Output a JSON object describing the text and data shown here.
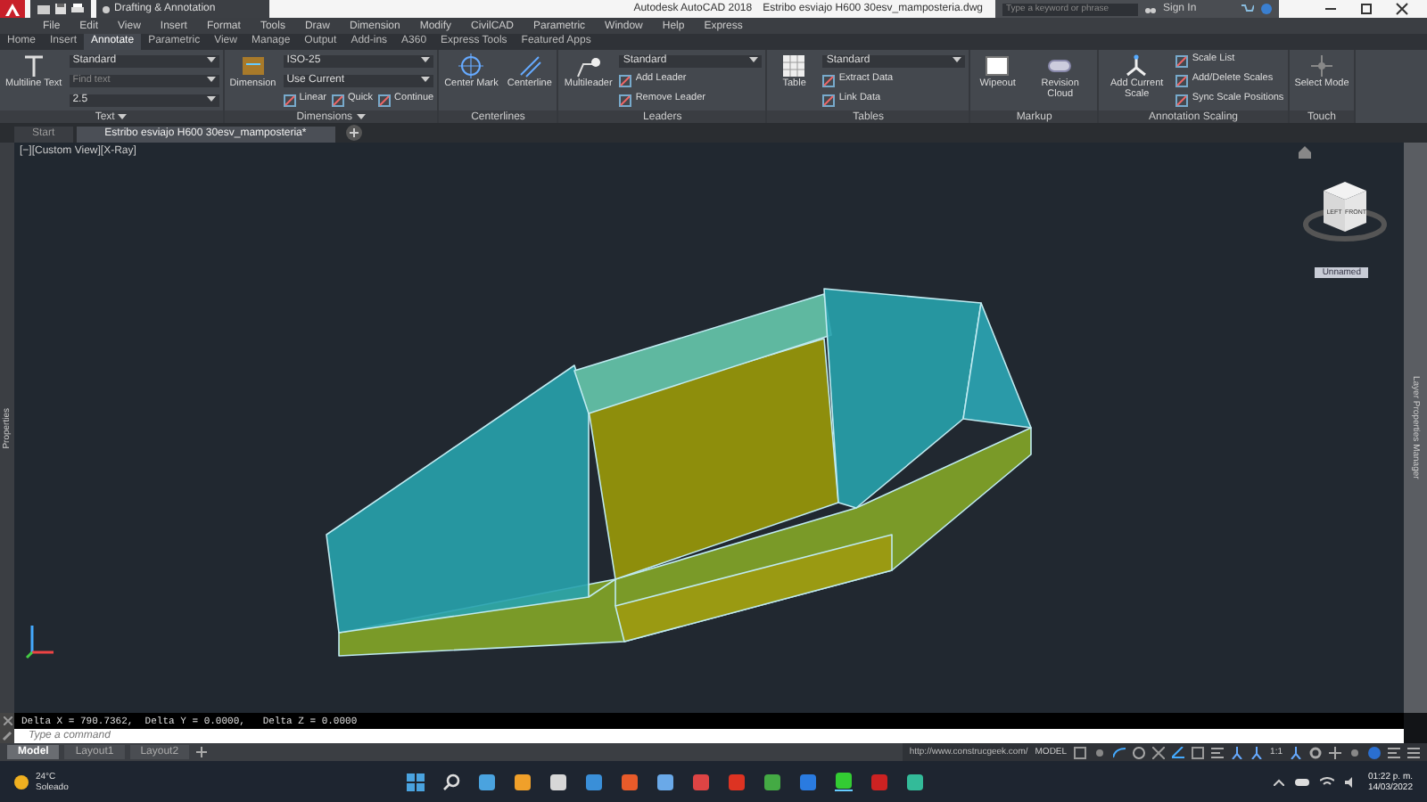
{
  "title_bar": {
    "workspace": "Drafting & Annotation",
    "title": "Autodesk AutoCAD 2018",
    "file": "Estribo esviajo H600 30esv_mamposteria.dwg",
    "search": {
      "placeholder": "Type a keyword or phrase"
    },
    "sign_in": "Sign In"
  },
  "menu": [
    "File",
    "Edit",
    "View",
    "Insert",
    "Format",
    "Tools",
    "Draw",
    "Dimension",
    "Modify",
    "CivilCAD",
    "Parametric",
    "Window",
    "Help",
    "Express"
  ],
  "ribbon_tabs": [
    {
      "label": "Home",
      "selected": false
    },
    {
      "label": "Insert",
      "selected": false
    },
    {
      "label": "Annotate",
      "selected": true
    },
    {
      "label": "Parametric",
      "selected": false
    },
    {
      "label": "View",
      "selected": false
    },
    {
      "label": "Manage",
      "selected": false
    },
    {
      "label": "Output",
      "selected": false
    },
    {
      "label": "Add-ins",
      "selected": false
    },
    {
      "label": "A360",
      "selected": false
    },
    {
      "label": "Express Tools",
      "selected": false
    },
    {
      "label": "Featured Apps",
      "selected": false
    }
  ],
  "ribbon_panels": [
    {
      "title": "Text",
      "expandable": true,
      "bigs": [
        "Multiline Text"
      ],
      "rows": [
        [
          {
            "kind": "combo",
            "value": "Standard"
          }
        ],
        [
          {
            "kind": "combo",
            "placeholder": "Find text"
          }
        ],
        [
          {
            "kind": "combo",
            "value": "2.5"
          }
        ]
      ]
    },
    {
      "title": "Dimensions",
      "expandable": true,
      "bigs": [
        "Dimension"
      ],
      "rows": [
        [
          {
            "kind": "combo",
            "value": "ISO-25"
          }
        ],
        [
          {
            "kind": "combo",
            "value": "Use Current"
          }
        ],
        [
          {
            "kind": "tool",
            "label": "Linear"
          },
          {
            "kind": "tool",
            "label": "Quick"
          },
          {
            "kind": "tool",
            "label": "Continue"
          }
        ]
      ]
    },
    {
      "title": "Centerlines",
      "expandable": false,
      "bigs": [
        "Center Mark",
        "Centerline"
      ]
    },
    {
      "title": "Leaders",
      "expandable": false,
      "bigs": [
        "Multileader"
      ],
      "rows": [
        [
          {
            "kind": "combo",
            "value": "Standard"
          }
        ],
        [
          {
            "kind": "tool",
            "label": "Add Leader"
          }
        ],
        [
          {
            "kind": "tool",
            "label": "Remove Leader"
          }
        ]
      ]
    },
    {
      "title": "Tables",
      "expandable": false,
      "bigs": [
        "Table"
      ],
      "rows": [
        [
          {
            "kind": "combo",
            "value": "Standard"
          }
        ],
        [
          {
            "kind": "tool",
            "label": "Extract Data"
          }
        ],
        [
          {
            "kind": "tool",
            "label": "Link Data"
          }
        ]
      ]
    },
    {
      "title": "Markup",
      "expandable": false,
      "bigs": [
        "Wipeout",
        "Revision Cloud"
      ]
    },
    {
      "title": "Annotation Scaling",
      "expandable": false,
      "bigs": [
        "Add Current Scale"
      ],
      "rows": [
        [
          {
            "kind": "tool",
            "label": "Scale List"
          }
        ],
        [
          {
            "kind": "tool",
            "label": "Add/Delete Scales"
          }
        ],
        [
          {
            "kind": "tool",
            "label": "Sync Scale Positions"
          }
        ]
      ]
    },
    {
      "title": "Touch",
      "expandable": false,
      "bigs": [
        "Select Mode"
      ]
    }
  ],
  "doc_tabs": [
    {
      "label": "Start",
      "selected": false
    },
    {
      "label": "Estribo esviajo H600 30esv_mamposteria*",
      "selected": true
    }
  ],
  "viewport": {
    "label": "[−][Custom View][X-Ray]",
    "view_name": "Unnamed",
    "cube_faces": [
      "LEFT",
      "FRONT"
    ]
  },
  "side_palettes": {
    "left": "Properties",
    "right": "Layer Properties Manager"
  },
  "command_line": {
    "history": "Delta X = 790.7362,  Delta Y = 0.0000,   Delta Z = 0.0000",
    "placeholder": "Type a command"
  },
  "layout_tabs": [
    {
      "label": "Model",
      "selected": true
    },
    {
      "label": "Layout1",
      "selected": false
    },
    {
      "label": "Layout2",
      "selected": false
    }
  ],
  "status_bar": {
    "url": "http://www.construcgeek.com/",
    "space": "MODEL",
    "scale": "1:1"
  },
  "taskbar": {
    "temperature": "24°C",
    "condition": "Soleado",
    "time": "01:22 p. m.",
    "date": "14/03/2022"
  }
}
